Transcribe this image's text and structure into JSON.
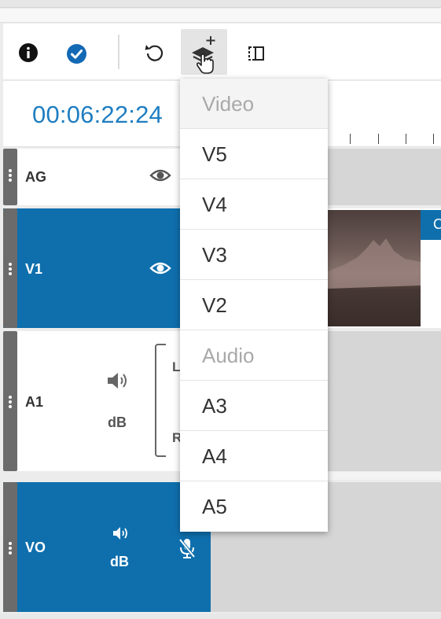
{
  "toolbar": {
    "info_icon": "info-icon",
    "check_icon": "check-circle-icon",
    "undo_icon": "undo-icon",
    "add_track_icon": "layers-add-icon",
    "split_icon": "split-icon"
  },
  "timecode": "00:06:22:24",
  "tracks": [
    {
      "name": "AG"
    },
    {
      "name": "V1"
    },
    {
      "name": "A1",
      "db_label": "dB",
      "left_label": "L",
      "right_label": "R"
    },
    {
      "name": "VO",
      "db_label": "dB"
    }
  ],
  "dropdown": {
    "video_header": "Video",
    "video_items": [
      "V5",
      "V4",
      "V3",
      "V2"
    ],
    "audio_header": "Audio",
    "audio_items": [
      "A3",
      "A4",
      "A5"
    ]
  },
  "clip_label": "C",
  "colors": {
    "accent": "#1f7ec1",
    "track_blue": "#0f6fad",
    "grip": "#6b6b6b"
  }
}
